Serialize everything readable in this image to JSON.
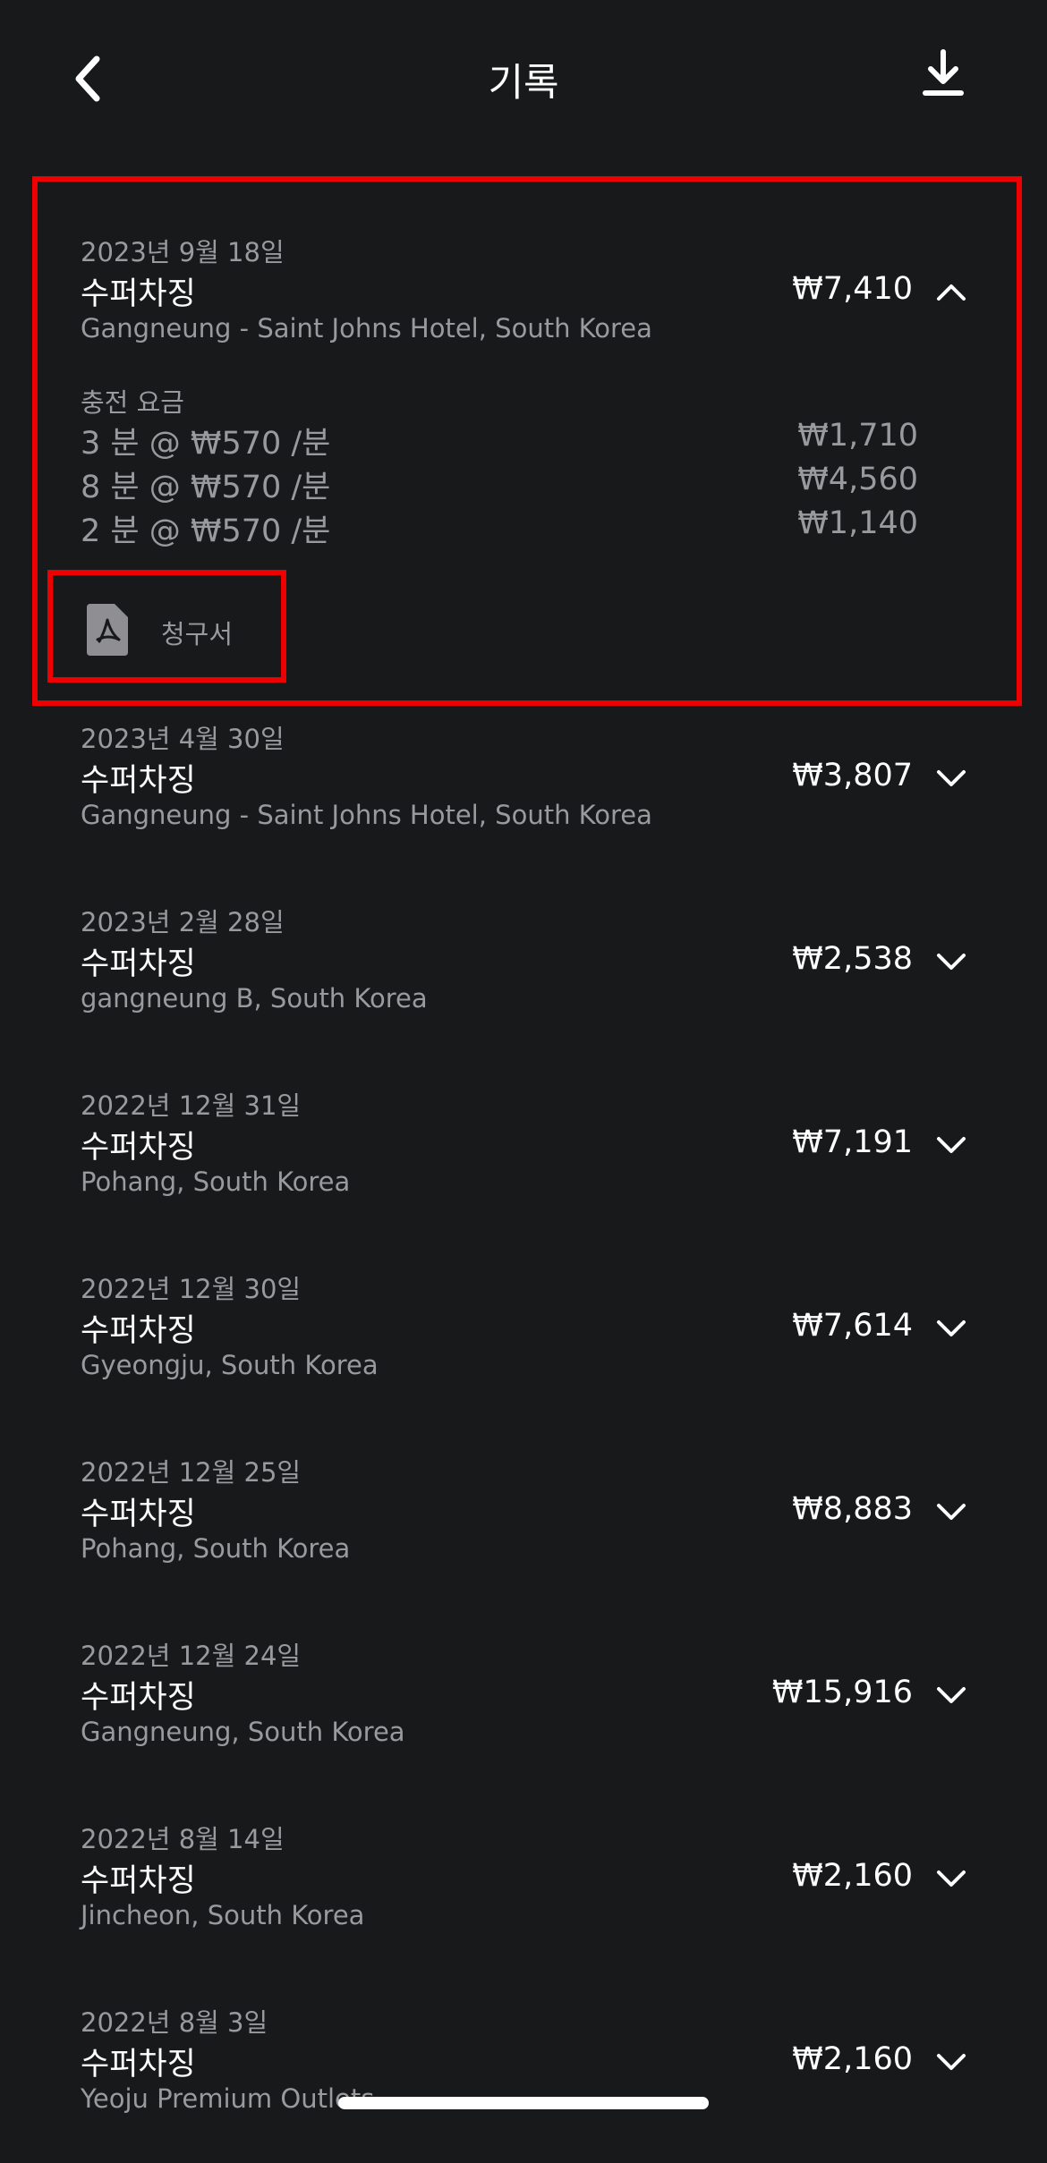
{
  "header": {
    "title": "기록",
    "back_icon": "chevron-left-icon",
    "download_icon": "download-icon"
  },
  "expanded_entry": {
    "date": "2023년 9월 18일",
    "type": "수퍼차징",
    "location": "Gangneung - Saint Johns Hotel, South Korea",
    "amount": "₩7,410",
    "fees_label": "충전 요금",
    "fee_lines": [
      {
        "desc": "3 분 @ ₩570 /분",
        "amount": "₩1,710"
      },
      {
        "desc": "8 분 @ ₩570 /분",
        "amount": "₩4,560"
      },
      {
        "desc": "2 분 @ ₩570 /분",
        "amount": "₩1,140"
      }
    ],
    "invoice_label": "청구서",
    "invoice_icon": "pdf-file-icon"
  },
  "entries": [
    {
      "date": "2023년 4월 30일",
      "type": "수퍼차징",
      "location": "Gangneung - Saint Johns Hotel, South Korea",
      "amount": "₩3,807"
    },
    {
      "date": "2023년 2월 28일",
      "type": "수퍼차징",
      "location": "gangneung B, South Korea",
      "amount": "₩2,538"
    },
    {
      "date": "2022년 12월 31일",
      "type": "수퍼차징",
      "location": "Pohang, South Korea",
      "amount": "₩7,191"
    },
    {
      "date": "2022년 12월 30일",
      "type": "수퍼차징",
      "location": "Gyeongju, South Korea",
      "amount": "₩7,614"
    },
    {
      "date": "2022년 12월 25일",
      "type": "수퍼차징",
      "location": "Pohang, South Korea",
      "amount": "₩8,883"
    },
    {
      "date": "2022년 12월 24일",
      "type": "수퍼차징",
      "location": "Gangneung, South Korea",
      "amount": "₩15,916"
    },
    {
      "date": "2022년 8월 14일",
      "type": "수퍼차징",
      "location": "Jincheon, South Korea",
      "amount": "₩2,160"
    },
    {
      "date": "2022년 8월 3일",
      "type": "수퍼차징",
      "location": "Yeoju Premium Outlets",
      "amount": "₩2,160"
    }
  ],
  "colors": {
    "background": "#18191b",
    "primary_text": "#ffffff",
    "secondary_text": "#9a9a9e",
    "highlight": "#ee0000"
  }
}
